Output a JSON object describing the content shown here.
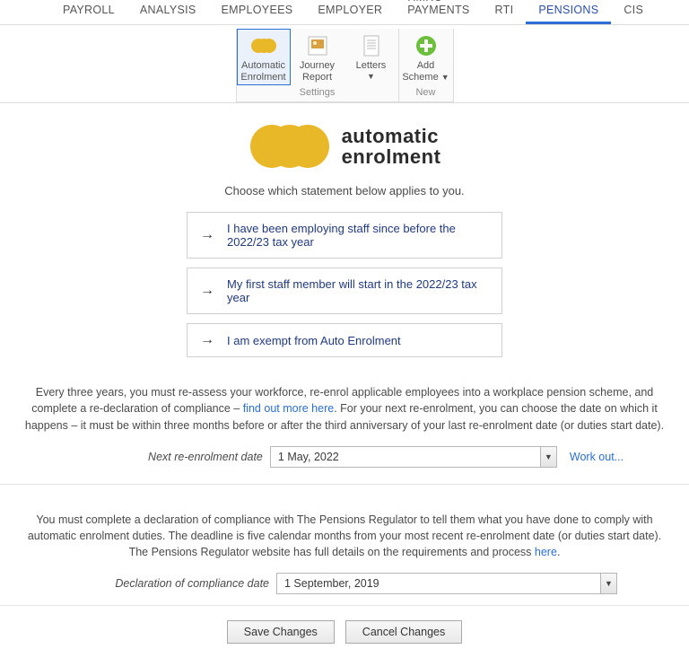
{
  "tabs": {
    "items": [
      {
        "label": "PAYROLL"
      },
      {
        "label": "ANALYSIS"
      },
      {
        "label": "EMPLOYEES"
      },
      {
        "label": "EMPLOYER"
      },
      {
        "label": "HMRC PAYMENTS"
      },
      {
        "label": "RTI"
      },
      {
        "label": "PENSIONS"
      },
      {
        "label": "CIS"
      }
    ],
    "active_index": 6
  },
  "ribbon": {
    "groups": [
      {
        "label": "Settings",
        "items": [
          {
            "line1": "Automatic",
            "line2": "Enrolment",
            "icon": "coins-icon",
            "dropdown": false,
            "selected": true
          },
          {
            "line1": "Journey",
            "line2": "Report",
            "icon": "image-icon",
            "dropdown": false,
            "selected": false
          },
          {
            "line1": "Letters",
            "line2": "",
            "icon": "document-icon",
            "dropdown": true,
            "selected": false
          }
        ]
      },
      {
        "label": "New",
        "items": [
          {
            "line1": "Add",
            "line2": "Scheme",
            "icon": "plus-circle-icon",
            "dropdown": true,
            "selected": false
          }
        ]
      }
    ]
  },
  "logo": {
    "line1": "automatic",
    "line2": "enrolment"
  },
  "subheading": "Choose which statement below applies to you.",
  "options": [
    "I have been employing staff since before the 2022/23 tax year",
    "My first staff member will start in the 2022/23 tax year",
    "I am exempt from Auto Enrolment"
  ],
  "para1": {
    "pre": "Every three years, you must re-assess your workforce, re-enrol applicable employees into a workplace pension scheme, and complete a re-declaration of compliance – ",
    "link": "find out more here",
    "post": ". For your next re-enrolment, you can choose the date on which it happens – it must be within three months before or after the third anniversary of your last re-enrolment date (or duties start date)."
  },
  "field1": {
    "label": "Next re-enrolment date",
    "value": "1 May, 2022",
    "work_out": "Work out..."
  },
  "para2": {
    "pre": "You must complete a declaration of compliance with The Pensions Regulator to tell them what you have done to comply with automatic enrolment duties. The deadline is five calendar months from your most recent re-enrolment date (or duties start date). The Pensions Regulator website has full details on the requirements and process ",
    "link": "here",
    "post": "."
  },
  "field2": {
    "label": "Declaration of compliance date",
    "value": "1 September, 2019"
  },
  "buttons": {
    "save": "Save Changes",
    "cancel": "Cancel Changes"
  },
  "caret": "▼"
}
